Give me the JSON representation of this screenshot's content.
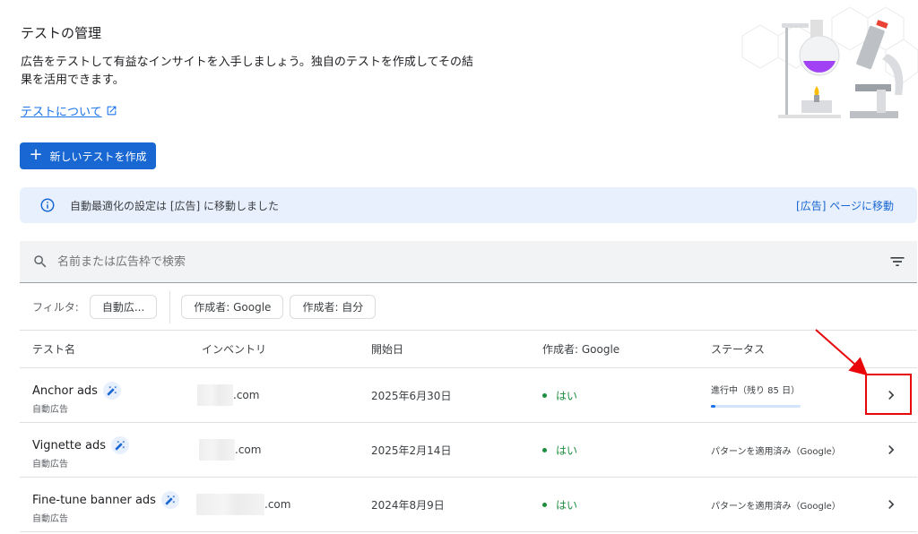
{
  "header": {
    "title": "テストの管理",
    "description": "広告をテストして有益なインサイトを入手しましょう。独自のテストを作成してその結果を活用できます。",
    "about_link": "テストについて"
  },
  "create_button": {
    "label": "新しいテストを作成"
  },
  "info_banner": {
    "text": "自動最適化の設定は [広告] に移動しました",
    "link": "[広告] ページに移動"
  },
  "search": {
    "placeholder": "名前または広告枠で検索"
  },
  "filters": {
    "label": "フィルタ:",
    "chips": [
      "自動広...",
      "作成者: Google",
      "作成者: 自分"
    ]
  },
  "table": {
    "columns": [
      "テスト名",
      "インベントリ",
      "開始日",
      "作成者: Google",
      "ステータス"
    ],
    "rows": [
      {
        "name": "Anchor ads",
        "type": "自動広告",
        "inventory_suffix": ".com",
        "start": "2025年6月30日",
        "google": "はい",
        "status": "進行中（残り 85 日）",
        "progress": 0.05
      },
      {
        "name": "Vignette ads",
        "type": "自動広告",
        "inventory_suffix": ".com",
        "start": "2025年2月14日",
        "google": "はい",
        "status": "パターンを適用済み（Google）"
      },
      {
        "name": "Fine-tune banner ads",
        "type": "自動広告",
        "inventory_suffix": ".com",
        "start": "2024年8月9日",
        "google": "はい",
        "status": "パターンを適用済み（Google）"
      }
    ]
  },
  "colors": {
    "primary": "#1967d2",
    "link": "#1a73e8",
    "success": "#1e8e3e",
    "annotation": "#e8060a"
  },
  "icons": [
    "external-link-icon",
    "plus-icon",
    "info-icon",
    "search-icon",
    "filter-list-icon",
    "magic-wand-icon",
    "chevron-right-icon"
  ]
}
